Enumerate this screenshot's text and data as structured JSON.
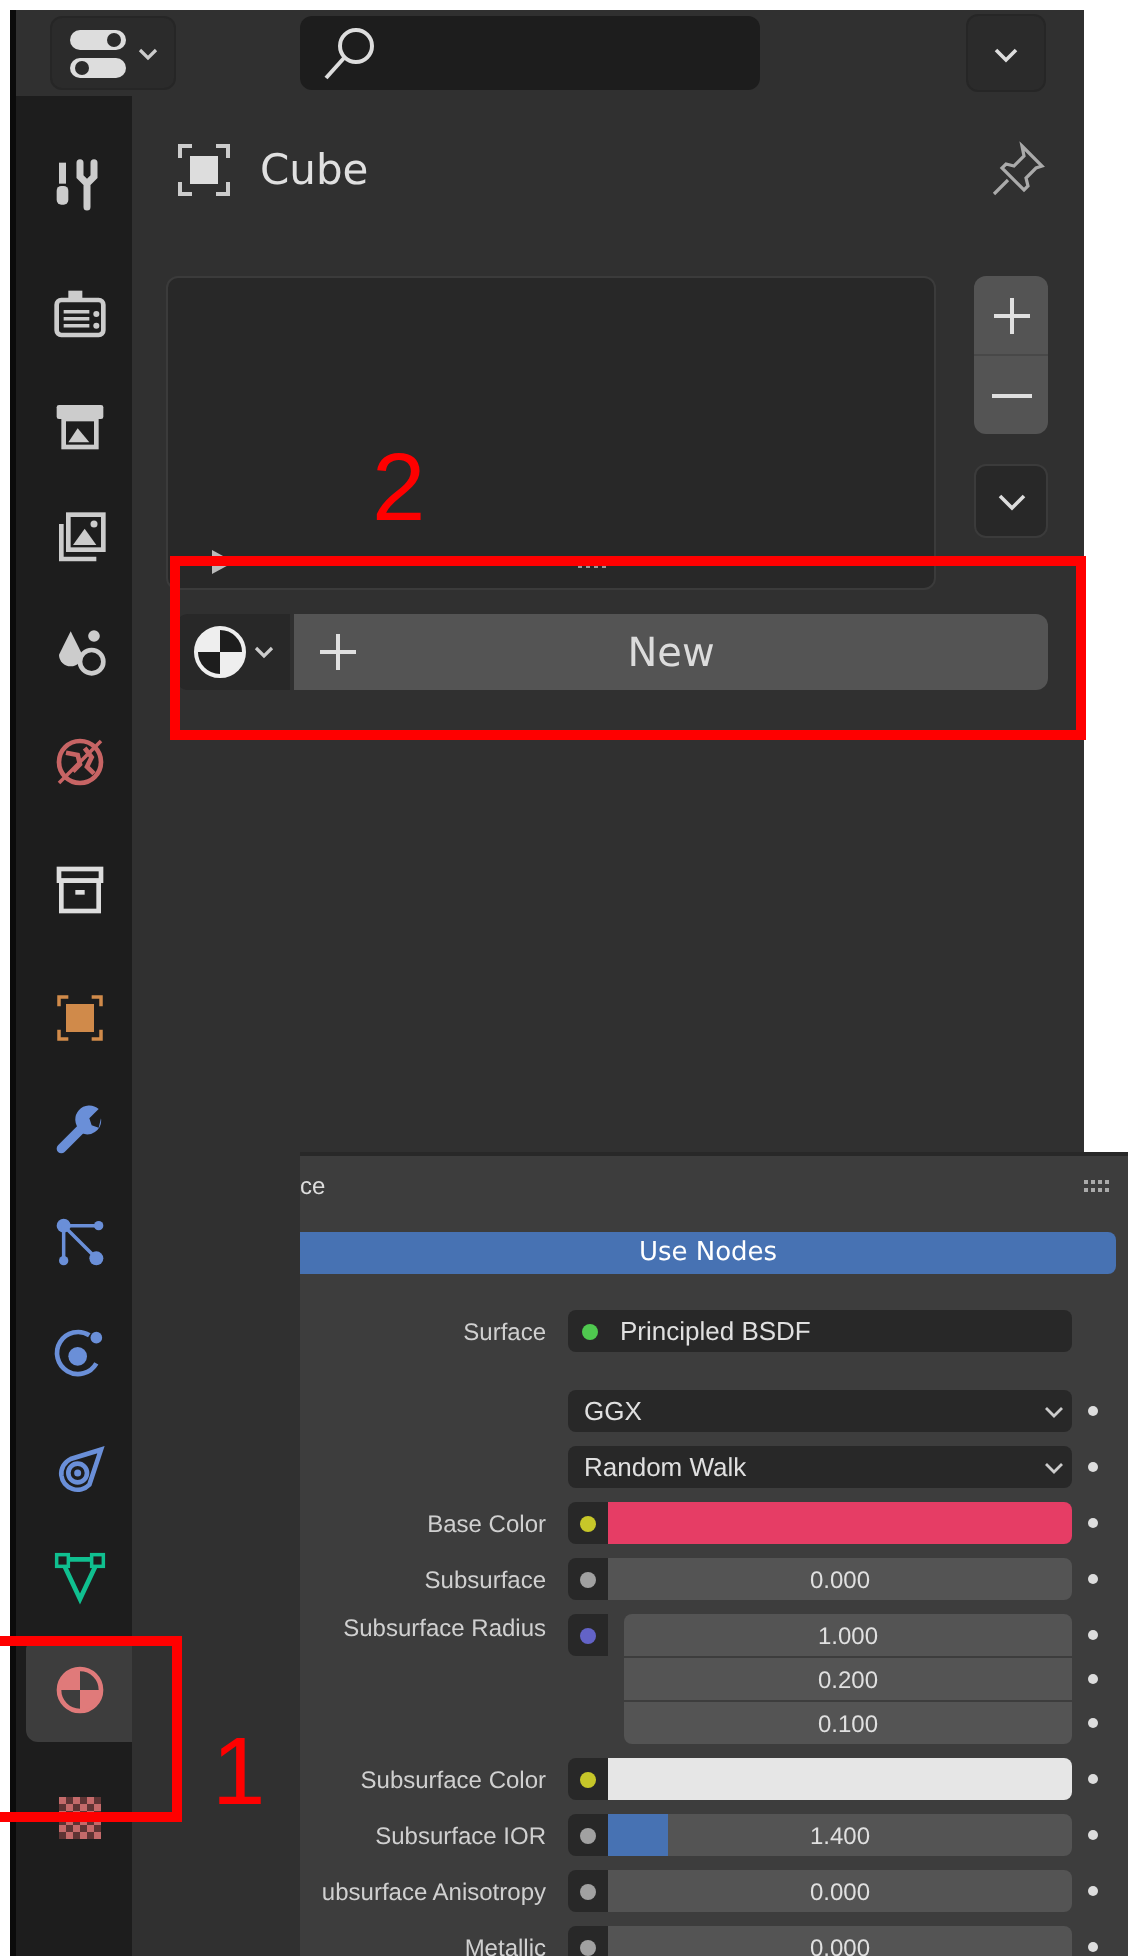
{
  "header": {
    "search": {
      "kind": "search"
    }
  },
  "sidebar": {
    "groups": [
      [
        {
          "selected": false
        }
      ],
      [
        {
          "selected": false
        },
        {
          "selected": false
        },
        {
          "selected": false
        },
        {
          "selected": false
        },
        {
          "selected": false
        }
      ],
      [
        {
          "selected": false
        }
      ],
      [
        {
          "selected": false
        },
        {
          "selected": false
        },
        {
          "selected": false
        },
        {
          "selected": false
        },
        {
          "selected": false
        },
        {
          "selected": false
        },
        {
          "selected": true
        }
      ],
      [
        {
          "selected": false
        }
      ]
    ]
  },
  "context": {
    "name": "Cube"
  },
  "material_slots": {
    "new_button": {
      "label": "New"
    }
  },
  "node_panel": {
    "header": "ce",
    "use_nodes": {
      "label": "Use Nodes",
      "on": true
    },
    "rows": [
      {
        "kind": "shader",
        "label": "Surface",
        "socket": {
          "color": "#4fc94f"
        },
        "value": "Principled BSDF"
      },
      {
        "kind": "menu",
        "value": "GGX"
      },
      {
        "kind": "menu",
        "value": "Random Walk"
      },
      {
        "kind": "color",
        "label": "Base Color",
        "socket": {
          "color": "#c7c729"
        },
        "swatch": {
          "color": "#e63d65"
        }
      },
      {
        "kind": "number",
        "label": "Subsurface",
        "socket": {
          "color": "#a1a1a1"
        },
        "value": "0.000"
      },
      {
        "kind": "vector",
        "label": "Subsurface Radius",
        "socket": {
          "color": "#6363c7"
        },
        "values": [
          "1.000",
          "0.200",
          "0.100"
        ]
      },
      {
        "kind": "color",
        "label": "Subsurface Color",
        "socket": {
          "color": "#c7c729"
        },
        "swatch": {
          "color": "#e6e6e6"
        }
      },
      {
        "kind": "number",
        "label": "Subsurface IOR",
        "socket": {
          "color": "#a1a1a1"
        },
        "value": "1.400",
        "level": 0.13
      },
      {
        "kind": "number",
        "label": "ubsurface Anisotropy",
        "socket": {
          "color": "#a1a1a1"
        },
        "value": "0.000"
      },
      {
        "kind": "number",
        "label": "Metallic",
        "socket": {
          "color": "#a1a1a1"
        },
        "value": "0.000"
      }
    ]
  },
  "annotations": [
    {
      "label": "2"
    },
    {
      "label": "1"
    }
  ]
}
